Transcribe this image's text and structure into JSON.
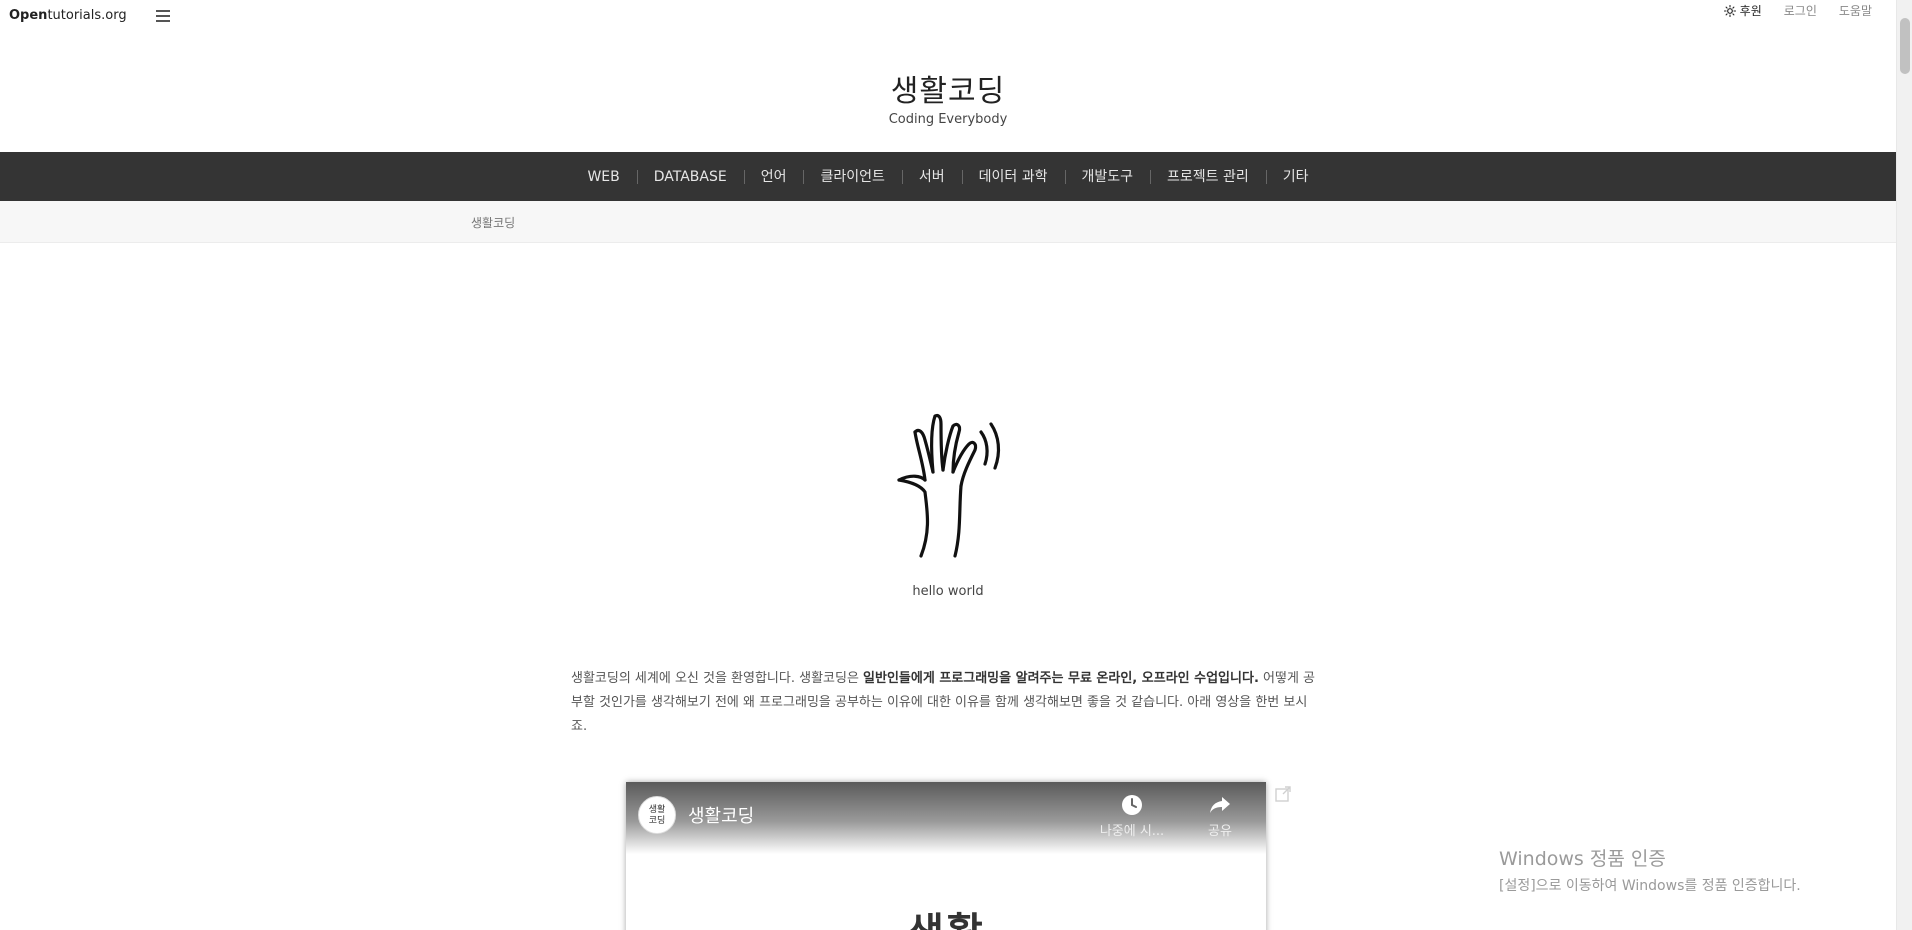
{
  "topbar": {
    "brand_bold": "Open",
    "brand_rest": "tutorials.org",
    "links": {
      "donate": "후원",
      "login": "로그인",
      "help": "도움말"
    }
  },
  "header": {
    "title": "생활코딩",
    "subtitle": "Coding Everybody"
  },
  "nav": {
    "items": [
      "WEB",
      "DATABASE",
      "언어",
      "클라이언트",
      "서버",
      "데이터 과학",
      "개발도구",
      "프로젝트 관리",
      "기타"
    ]
  },
  "breadcrumb": {
    "current": "생활코딩"
  },
  "content": {
    "hero_caption": "hello world",
    "intro_part1": "생활코딩의 세계에 오신 것을 환영합니다. 생활코딩은 ",
    "intro_bold": "일반인들에게 프로그래밍을 알려주는 무료 온라인, 오프라인 수업입니다.",
    "intro_part2": " 어떻게 공부할 것인가를 생각해보기 전에 왜 프로그래밍을 공부하는 이유에 대한 이유를 함께 생각해보면 좋을 것 같습니다. 아래 영상을 한번 보시죠."
  },
  "video": {
    "channel_avatar_text": "생활\n코딩",
    "title": "생활코딩",
    "watch_later": "나중에 시...",
    "share": "공유",
    "big_text": "생활"
  },
  "watermark": {
    "title": "Windows 정품 인증",
    "subtitle": "[설정]으로 이동하여 Windows를 정품 인증합니다."
  }
}
